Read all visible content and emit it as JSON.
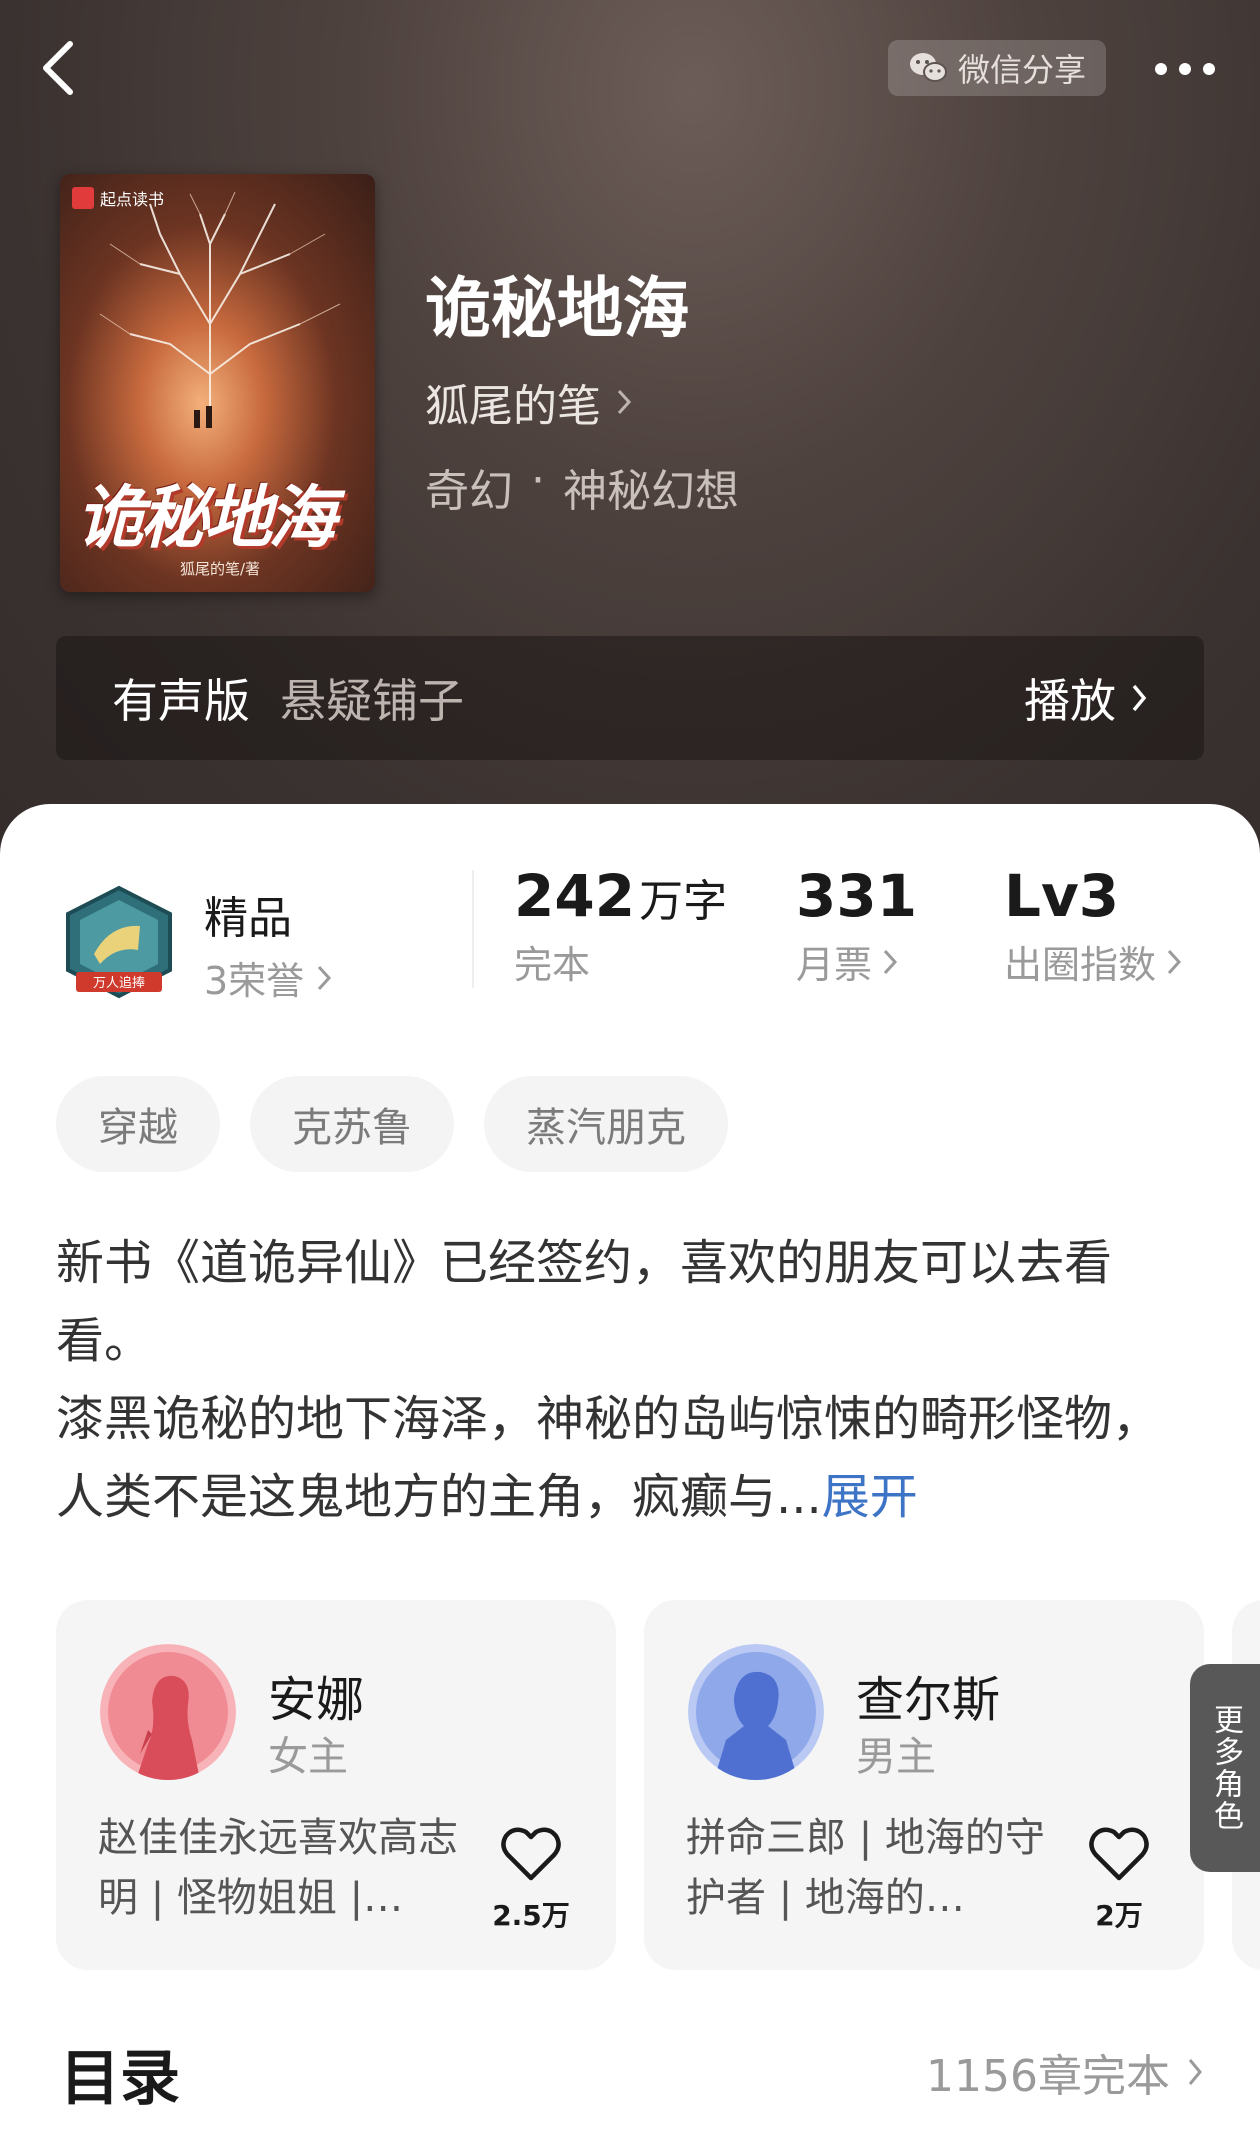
{
  "header": {
    "share_label": "微信分享",
    "back_icon": "chevron-left-icon",
    "share_icon": "wechat-icon",
    "more_icon": "more-dots-icon"
  },
  "book": {
    "title": "诡秘地海",
    "author": "狐尾的笔",
    "genre_main": "奇幻",
    "genre_sep": "·",
    "genre_sub": "神秘幻想",
    "cover": {
      "brand": "起点读书",
      "title": "诡秘地海",
      "author_line": "狐尾的笔/著"
    }
  },
  "audio": {
    "label": "有声版",
    "narrator": "悬疑铺子",
    "play_label": "播放"
  },
  "stats": {
    "quality_label": "精品",
    "honors": "3荣誉",
    "badge_text": "万人追捧",
    "word_count": "242",
    "word_unit": "万字",
    "status": "完本",
    "monthly_votes": "331",
    "monthly_label": "月票",
    "level": "Lv3",
    "level_label": "出圈指数"
  },
  "tags": [
    "穿越",
    "克苏鲁",
    "蒸汽朋克"
  ],
  "synopsis": {
    "line1": "新书《道诡异仙》已经签约，喜欢的朋友可以去看看。",
    "line2": "漆黑诡秘的地下海泽，神秘的岛屿惊悚的畸形怪物，人类不是这鬼地方的主角，疯癫与...",
    "expand": "展开"
  },
  "characters": [
    {
      "name": "安娜",
      "role": "女主",
      "desc": "赵佳佳永远喜欢高志明 | 怪物姐姐 |…",
      "likes": "2.5万"
    },
    {
      "name": "查尔斯",
      "role": "男主",
      "desc": "拼命三郎 | 地海的守护者 | 地海的…",
      "likes": "2万"
    }
  ],
  "more_roles": "更多角色",
  "toc": {
    "title": "目录",
    "meta": "1156章完本"
  },
  "colors": {
    "hero_bg": "#3a3230",
    "link_blue": "#3e74c6",
    "tag_bg": "#f4f4f4",
    "card_bg": "#f5f5f5"
  }
}
